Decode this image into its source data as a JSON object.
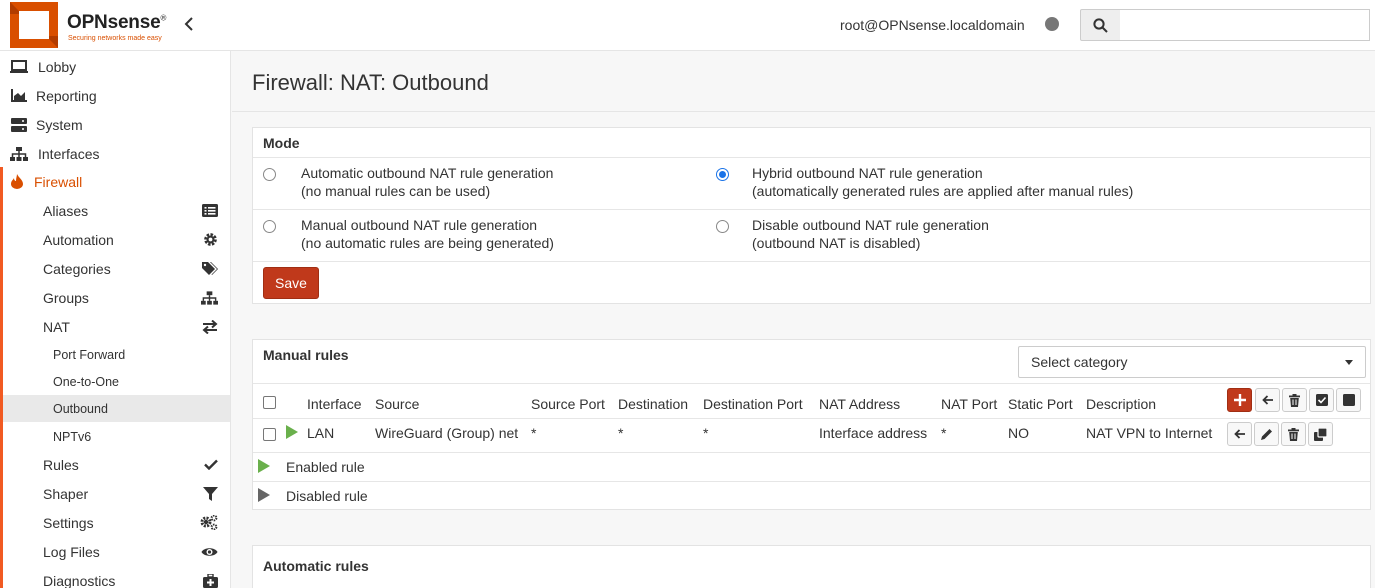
{
  "header": {
    "brand": "OPNsense",
    "brand_mark": "®",
    "tagline": "Securing networks made easy",
    "user": "root@OPNsense.localdomain",
    "search": {
      "placeholder": ""
    }
  },
  "sidebar": {
    "top_items": [
      {
        "label": "Lobby",
        "icon": "laptop-icon"
      },
      {
        "label": "Reporting",
        "icon": "area-chart-icon"
      },
      {
        "label": "System",
        "icon": "server-icon"
      },
      {
        "label": "Interfaces",
        "icon": "sitemap-icon"
      },
      {
        "label": "Firewall",
        "icon": "fire-icon"
      }
    ],
    "firewall_items": {
      "aliases": "Aliases",
      "automation": "Automation",
      "categories": "Categories",
      "groups": "Groups",
      "nat": "NAT",
      "port_forward": "Port Forward",
      "one_to_one": "One-to-One",
      "outbound": "Outbound",
      "nptv6": "NPTv6",
      "rules": "Rules",
      "shaper": "Shaper",
      "settings": "Settings",
      "log_files": "Log Files",
      "diagnostics": "Diagnostics"
    }
  },
  "main": {
    "title": "Firewall: NAT: Outbound",
    "mode": {
      "heading": "Mode",
      "options": [
        {
          "line1": "Automatic outbound NAT rule generation",
          "line2": "(no manual rules can be used)",
          "selected": false
        },
        {
          "line1": "Hybrid outbound NAT rule generation",
          "line2": "(automatically generated rules are applied after manual rules)",
          "selected": true
        },
        {
          "line1": "Manual outbound NAT rule generation",
          "line2": "(no automatic rules are being generated)",
          "selected": false
        },
        {
          "line1": "Disable outbound NAT rule generation",
          "line2": "(outbound NAT is disabled)",
          "selected": false
        }
      ],
      "save_label": "Save"
    },
    "manual_rules": {
      "heading": "Manual rules",
      "category_select": "Select category",
      "columns": {
        "interface": "Interface",
        "source": "Source",
        "source_port": "Source Port",
        "destination": "Destination",
        "destination_port": "Destination Port",
        "nat_address": "NAT Address",
        "nat_port": "NAT Port",
        "static_port": "Static Port",
        "description": "Description"
      },
      "rows": [
        {
          "interface": "LAN",
          "source": "WireGuard (Group) net",
          "source_port": "*",
          "destination": "*",
          "destination_port": "*",
          "nat_address": "Interface address",
          "nat_port": "*",
          "static_port": "NO",
          "description": "NAT VPN to Internet"
        }
      ],
      "legend": {
        "enabled": "Enabled rule",
        "disabled": "Disabled rule"
      }
    },
    "automatic_rules": {
      "heading": "Automatic rules"
    }
  },
  "colors": {
    "accent": "#d94f00",
    "save": "#c0391b",
    "enabled": "#6ab04c"
  }
}
